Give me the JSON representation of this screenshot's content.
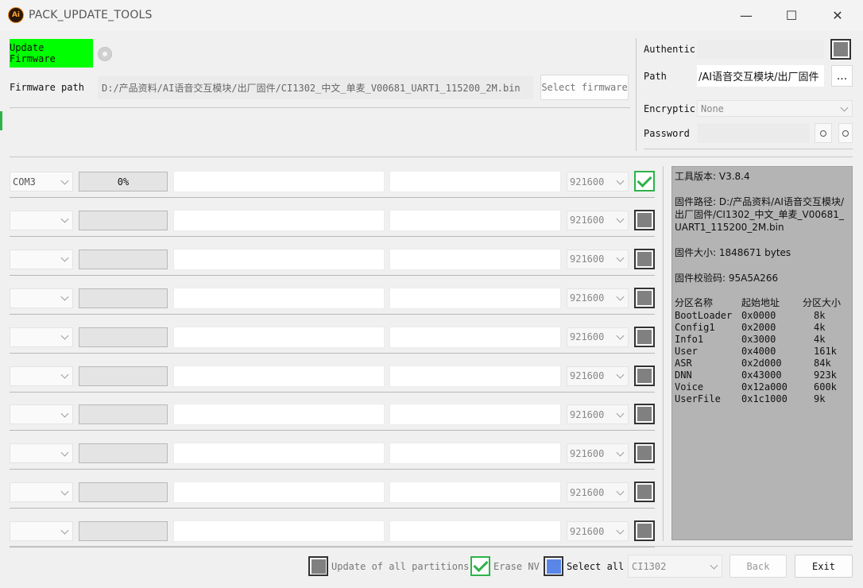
{
  "window": {
    "title": "PACK_UPDATE_TOOLS",
    "icon_text": "Ai",
    "minimize": "—",
    "maximize": "☐",
    "close": "✕"
  },
  "top": {
    "update_button": "Update Firmware",
    "firmware_path_label": "Firmware path",
    "firmware_path_value": "D:/产品资料/AI语音交互模块/出厂固件/CI1302_中文_单麦_V00681_UART1_115200_2M.bin",
    "select_firmware": "Select firmware"
  },
  "auth": {
    "authentic_label": "Authentic",
    "path_label": "Path",
    "path_value": "/AI语音交互模块/出厂固件",
    "browse": "...",
    "encryption_label": "Encryptic",
    "encryption_value": "None",
    "password_label": "Password"
  },
  "rows": [
    {
      "port": "COM3",
      "progress": "0%",
      "baud": "921600",
      "checked": true
    },
    {
      "port": "",
      "progress": "",
      "baud": "921600",
      "checked": false
    },
    {
      "port": "",
      "progress": "",
      "baud": "921600",
      "checked": false
    },
    {
      "port": "",
      "progress": "",
      "baud": "921600",
      "checked": false
    },
    {
      "port": "",
      "progress": "",
      "baud": "921600",
      "checked": false
    },
    {
      "port": "",
      "progress": "",
      "baud": "921600",
      "checked": false
    },
    {
      "port": "",
      "progress": "",
      "baud": "921600",
      "checked": false
    },
    {
      "port": "",
      "progress": "",
      "baud": "921600",
      "checked": false
    },
    {
      "port": "",
      "progress": "",
      "baud": "921600",
      "checked": false
    },
    {
      "port": "",
      "progress": "",
      "baud": "921600",
      "checked": false
    }
  ],
  "info": {
    "tool_version": "工具版本: V3.8.4",
    "firmware_path": "固件路径: D:/产品资料/AI语音交互模块/出厂固件/CI1302_中文_单麦_V00681_UART1_115200_2M.bin",
    "firmware_size": "固件大小: 1848671 bytes",
    "firmware_checksum": "固件校验码: 95A5A266",
    "partition_headers": [
      "分区名称",
      "起始地址",
      "分区大小"
    ],
    "partitions": [
      [
        "BootLoader",
        "0x0000",
        "8k"
      ],
      [
        "Config1",
        "0x2000",
        "4k"
      ],
      [
        "Info1",
        "0x3000",
        "4k"
      ],
      [
        "User",
        "0x4000",
        "161k"
      ],
      [
        "ASR",
        "0x2d000",
        "84k"
      ],
      [
        "DNN",
        "0x43000",
        "923k"
      ],
      [
        "Voice",
        "0x12a000",
        "600k"
      ],
      [
        "UserFile",
        "0x1c1000",
        "9k"
      ]
    ]
  },
  "bottom": {
    "update_all_partitions": "Update of all partitions",
    "erase_nv": "Erase NV",
    "select_all": "Select all",
    "chip_value": "CI1302",
    "back": "Back",
    "exit": "Exit"
  },
  "colors": {
    "update_button_bg": "#00ff00",
    "check_green": "#2db34a",
    "select_all_blue": "#5a86e8",
    "info_panel_bg": "#b4b4b4"
  }
}
